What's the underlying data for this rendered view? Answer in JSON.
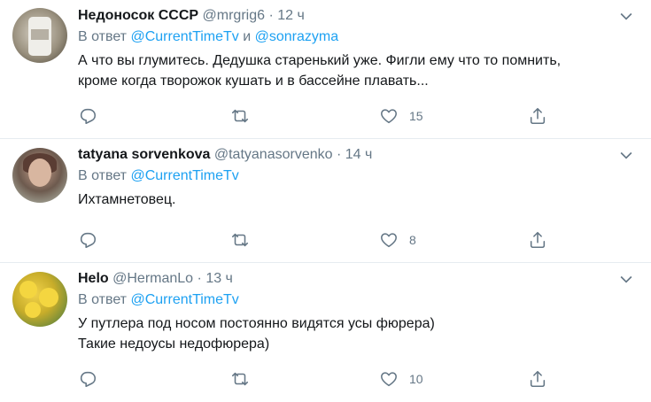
{
  "tweets": [
    {
      "name": "Недоносок СССР",
      "handle": "@mrgrig6",
      "time": "12 ч",
      "reply_prefix": "В ответ",
      "reply_to": "@CurrentTimeTv",
      "reply_conj": "и",
      "reply_to2": "@sonrazyma",
      "text_lines": [
        "А что вы глумитесь. Дедушка старенький уже. Фигли ему что то помнить,",
        "кроме когда творожок кушать и в бассейне плавать..."
      ],
      "likes": "15"
    },
    {
      "name": "tatyana sorvenkova",
      "handle": "@tatyanasorvenko",
      "time": "14 ч",
      "reply_prefix": "В ответ",
      "reply_to": "@CurrentTimeTv",
      "text_lines": [
        "Ихтамнетовец."
      ],
      "likes": "8"
    },
    {
      "name": "Helo",
      "handle": "@HermanLo",
      "time": "13 ч",
      "reply_prefix": "В ответ",
      "reply_to": "@CurrentTimeTv",
      "text_lines": [
        "У путлера под носом постоянно видятся усы фюрера)",
        "Такие недоусы недофюрера)"
      ],
      "likes": "10"
    }
  ],
  "separator": "·",
  "colors": {
    "link": "#1da1f2",
    "muted": "#657786",
    "text": "#14171a",
    "divider": "#e6ecf0"
  },
  "icons": [
    "reply-icon",
    "retweet-icon",
    "like-icon",
    "share-icon",
    "chevron-down-icon"
  ]
}
